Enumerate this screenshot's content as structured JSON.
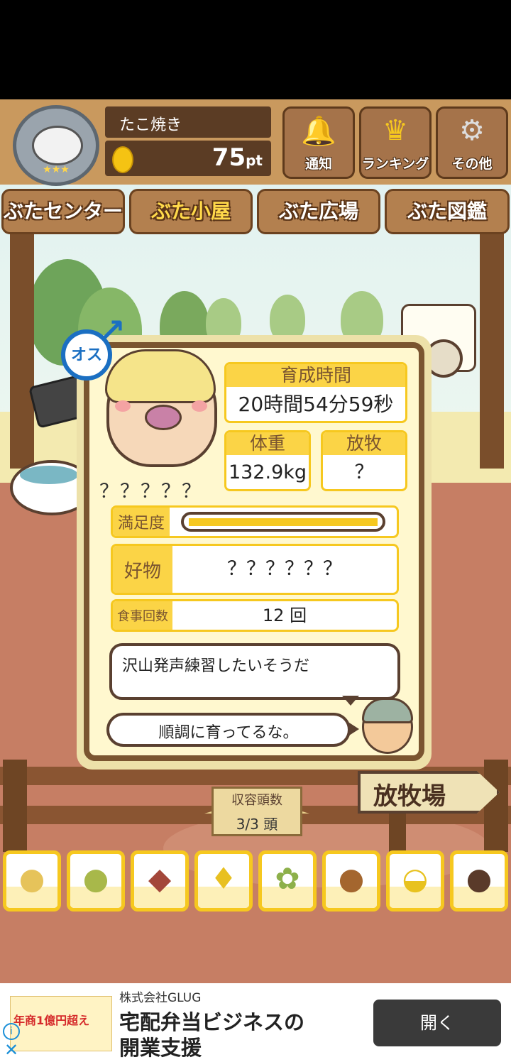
{
  "header": {
    "player_name": "たこ焼き",
    "points_value": "75",
    "points_unit": "pt",
    "buttons": [
      {
        "label": "通知",
        "icon": "bell-icon"
      },
      {
        "label": "ランキング",
        "icon": "crown-icon"
      },
      {
        "label": "その他",
        "icon": "gear-icon"
      }
    ]
  },
  "tabs": [
    {
      "label": "ぶたセンター"
    },
    {
      "label": "ぶた小屋",
      "active": true
    },
    {
      "label": "ぶた広場"
    },
    {
      "label": "ぶた図鑑"
    }
  ],
  "pig": {
    "gender_label": "オス",
    "name": "？？？？？",
    "stats": {
      "growth_time_label": "育成時間",
      "growth_time_value": "20時間54分59秒",
      "weight_label": "体重",
      "weight_value": "132.9kg",
      "pasture_label": "放牧",
      "pasture_value": "？"
    },
    "satisfaction_label": "満足度",
    "satisfaction_level": 1.0,
    "favorite_label": "好物",
    "favorite_value": "？？？？？？",
    "meals_label": "食事回数",
    "meals_value": "12 回"
  },
  "messages": {
    "pig_thought": "沢山発声練習したいそうだ",
    "farmer_comment": "順調に育ってるな。"
  },
  "capacity": {
    "label": "収容頭数",
    "value": "3/3 頭"
  },
  "pasture_sign": "放牧場",
  "food_items": [
    {
      "icon": "soybeans-icon"
    },
    {
      "icon": "mixed-beans-icon"
    },
    {
      "icon": "sweet-potato-icon"
    },
    {
      "icon": "corn-icon"
    },
    {
      "icon": "ginkgo-nuts-icon"
    },
    {
      "icon": "acorns-icon"
    },
    {
      "icon": "grain-bowl-icon"
    },
    {
      "icon": "dumplings-plate-icon"
    }
  ],
  "ad": {
    "advertiser": "株式会社GLUG",
    "headline_line1": "宅配弁当ビジネスの",
    "headline_line2": "開業支援",
    "button_label": "開く",
    "banner_text": "年商1億円超え"
  },
  "colors": {
    "accent_yellow": "#f6c81f",
    "wood_dark": "#7a5530",
    "gender_blue": "#1b6fc2"
  }
}
